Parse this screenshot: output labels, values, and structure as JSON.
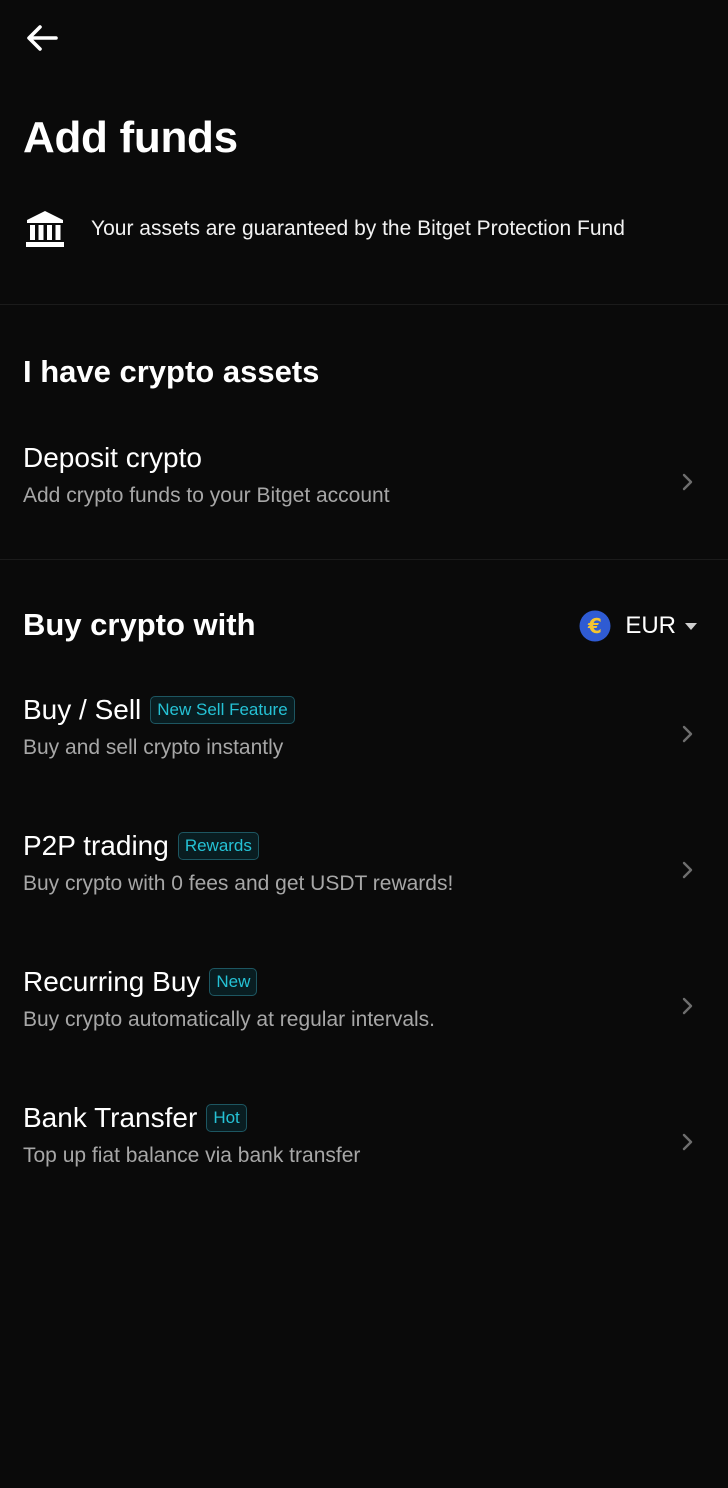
{
  "header": {
    "back_icon": "arrow-left-icon",
    "title": "Add funds"
  },
  "protection": {
    "icon": "bank-icon",
    "text": "Your assets are guaranteed by the Bitget Protection Fund"
  },
  "crypto_section": {
    "title": "I have crypto assets",
    "items": [
      {
        "title": "Deposit crypto",
        "subtitle": "Add crypto funds to your Bitget account"
      }
    ]
  },
  "buy_section": {
    "title": "Buy crypto with",
    "currency": {
      "code": "EUR",
      "symbol": "€",
      "icon": "euro-coin-icon",
      "coin_color": "#2f5bd3",
      "symbol_color": "#f4c430"
    },
    "items": [
      {
        "title": "Buy / Sell",
        "badge": "New Sell Feature",
        "subtitle": "Buy and sell crypto instantly"
      },
      {
        "title": "P2P trading",
        "badge": "Rewards",
        "subtitle": "Buy crypto with 0 fees and get USDT rewards!"
      },
      {
        "title": "Recurring Buy",
        "badge": "New",
        "subtitle": "Buy crypto automatically at regular intervals."
      },
      {
        "title": "Bank Transfer",
        "badge": "Hot",
        "subtitle": "Top up fiat balance via bank transfer"
      }
    ]
  },
  "colors": {
    "background": "#0a0a0a",
    "badge_text": "#25c2d5",
    "badge_border": "#1d5661",
    "secondary_text": "#a7a7a7"
  }
}
